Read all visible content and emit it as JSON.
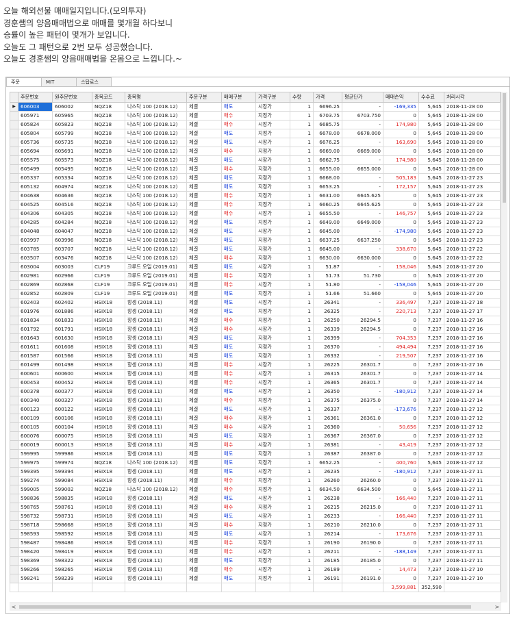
{
  "intro": [
    "오늘 해외선물 매매일지입니다.(모의투자)",
    "경훈쌤의 양음매매법으로 매매를 몇개월 하다보니",
    "승률이 높은 패턴이 몇개가 보입니다.",
    "오늘도 그 패턴으로 2번 모두 성공했습니다.",
    "오늘도 경훈쌤의 양음매매법을 온몸으로 느낍니다.~"
  ],
  "tabs": [
    "주문",
    "MIT",
    "스탑로스"
  ],
  "columns": [
    "주문번호",
    "원주문번호",
    "종목코드",
    "종목명",
    "주문구분",
    "매매구분",
    "가격구분",
    "수량",
    "가격",
    "평균단가",
    "매매손익",
    "수수료",
    "처리시각"
  ],
  "rows": [
    [
      "606003",
      "606002",
      "NQZ18",
      "나스닥 100 (2018.12)",
      "체결",
      "매도",
      "시장가",
      "1",
      "6696.25",
      "-",
      "-169,335",
      "5,645",
      "2018-11-28 00"
    ],
    [
      "605971",
      "605965",
      "NQZ18",
      "나스닥 100 (2018.12)",
      "체결",
      "매수",
      "지정가",
      "1",
      "6703.75",
      "6703.750",
      "0",
      "5,645",
      "2018-11-28 00"
    ],
    [
      "605824",
      "605823",
      "NQZ18",
      "나스닥 100 (2018.12)",
      "체결",
      "매수",
      "시장가",
      "1",
      "6685.75",
      "-",
      "174,980",
      "5,645",
      "2018-11-28 00"
    ],
    [
      "605804",
      "605799",
      "NQZ18",
      "나스닥 100 (2018.12)",
      "체결",
      "매도",
      "지정가",
      "1",
      "6678.00",
      "6678.000",
      "0",
      "5,645",
      "2018-11-28 00"
    ],
    [
      "605736",
      "605735",
      "NQZ18",
      "나스닥 100 (2018.12)",
      "체결",
      "매도",
      "시장가",
      "1",
      "6676.25",
      "-",
      "163,690",
      "5,645",
      "2018-11-28 00"
    ],
    [
      "605694",
      "605691",
      "NQZ18",
      "나스닥 100 (2018.12)",
      "체결",
      "매수",
      "지정가",
      "1",
      "6669.00",
      "6669.000",
      "0",
      "5,645",
      "2018-11-28 00"
    ],
    [
      "605575",
      "605573",
      "NQZ18",
      "나스닥 100 (2018.12)",
      "체결",
      "매도",
      "시장가",
      "1",
      "6662.75",
      "-",
      "174,980",
      "5,645",
      "2018-11-28 00"
    ],
    [
      "605499",
      "605495",
      "NQZ18",
      "나스닥 100 (2018.12)",
      "체결",
      "매수",
      "지정가",
      "1",
      "6655.00",
      "6655.000",
      "0",
      "5,645",
      "2018-11-28 00"
    ],
    [
      "605337",
      "605334",
      "NQZ18",
      "나스닥 100 (2018.12)",
      "체결",
      "매도",
      "지정가",
      "1",
      "6668.00",
      "-",
      "505,183",
      "5,645",
      "2018-11-27 23"
    ],
    [
      "605132",
      "604974",
      "NQZ18",
      "나스닥 100 (2018.12)",
      "체결",
      "매도",
      "지정가",
      "1",
      "6653.25",
      "-",
      "172,157",
      "5,645",
      "2018-11-27 23"
    ],
    [
      "604638",
      "604636",
      "NQZ18",
      "나스닥 100 (2018.12)",
      "체결",
      "매수",
      "지정가",
      "1",
      "6631.00",
      "6645.625",
      "0",
      "5,645",
      "2018-11-27 23"
    ],
    [
      "604525",
      "604516",
      "NQZ18",
      "나스닥 100 (2018.12)",
      "체결",
      "매수",
      "지정가",
      "1",
      "6660.25",
      "6645.625",
      "0",
      "5,645",
      "2018-11-27 23"
    ],
    [
      "604306",
      "604305",
      "NQZ18",
      "나스닥 100 (2018.12)",
      "체결",
      "매수",
      "시장가",
      "1",
      "6655.50",
      "-",
      "146,757",
      "5,645",
      "2018-11-27 23"
    ],
    [
      "604285",
      "604284",
      "NQZ18",
      "나스닥 100 (2018.12)",
      "체결",
      "매도",
      "지정가",
      "1",
      "6649.00",
      "6649.000",
      "0",
      "5,645",
      "2018-11-27 23"
    ],
    [
      "604048",
      "604047",
      "NQZ18",
      "나스닥 100 (2018.12)",
      "체결",
      "매도",
      "시장가",
      "1",
      "6645.00",
      "-",
      "-174,980",
      "5,645",
      "2018-11-27 23"
    ],
    [
      "603997",
      "603996",
      "NQZ18",
      "나스닥 100 (2018.12)",
      "체결",
      "매도",
      "지정가",
      "1",
      "6637.25",
      "6637.250",
      "0",
      "5,645",
      "2018-11-27 23"
    ],
    [
      "603785",
      "603707",
      "NQZ18",
      "나스닥 100 (2018.12)",
      "체결",
      "매도",
      "지정가",
      "1",
      "6645.00",
      "-",
      "338,670",
      "5,645",
      "2018-11-27 22"
    ],
    [
      "603507",
      "603476",
      "NQZ18",
      "나스닥 100 (2018.12)",
      "체결",
      "매수",
      "지정가",
      "1",
      "6630.00",
      "6630.000",
      "0",
      "5,645",
      "2018-11-27 22"
    ],
    [
      "603004",
      "603003",
      "CLF19",
      "크루드 오일 (2019.01)",
      "체결",
      "매도",
      "시장가",
      "1",
      "51.87",
      "-",
      "158,046",
      "5,645",
      "2018-11-27 20"
    ],
    [
      "602981",
      "602966",
      "CLF19",
      "크루드 오일 (2019.01)",
      "체결",
      "매수",
      "지정가",
      "1",
      "51.73",
      "51.730",
      "0",
      "5,645",
      "2018-11-27 20"
    ],
    [
      "602869",
      "602868",
      "CLF19",
      "크루드 오일 (2019.01)",
      "체결",
      "매수",
      "시장가",
      "1",
      "51.80",
      "-",
      "-158,046",
      "5,645",
      "2018-11-27 20"
    ],
    [
      "602852",
      "602809",
      "CLF19",
      "크루드 오일 (2019.01)",
      "체결",
      "매도",
      "지정가",
      "1",
      "51.66",
      "51.660",
      "0",
      "5,645",
      "2018-11-27 20"
    ],
    [
      "602403",
      "602402",
      "HSIX18",
      "항셍 (2018.11)",
      "체결",
      "매도",
      "시장가",
      "1",
      "26341",
      "-",
      "336,497",
      "7,237",
      "2018-11-27 18"
    ],
    [
      "601976",
      "601886",
      "HSIX18",
      "항셍 (2018.11)",
      "체결",
      "매도",
      "지정가",
      "1",
      "26325",
      "-",
      "220,713",
      "7,237",
      "2018-11-27 17"
    ],
    [
      "601834",
      "601833",
      "HSIX18",
      "항셍 (2018.11)",
      "체결",
      "매수",
      "지정가",
      "1",
      "26250",
      "26294.5",
      "0",
      "7,237",
      "2018-11-27 16"
    ],
    [
      "601792",
      "601791",
      "HSIX18",
      "항셍 (2018.11)",
      "체결",
      "매수",
      "시장가",
      "1",
      "26339",
      "26294.5",
      "0",
      "7,237",
      "2018-11-27 16"
    ],
    [
      "601643",
      "601630",
      "HSIX18",
      "항셍 (2018.11)",
      "체결",
      "매도",
      "지정가",
      "1",
      "26399",
      "-",
      "704,353",
      "7,237",
      "2018-11-27 16"
    ],
    [
      "601611",
      "601608",
      "HSIX18",
      "항셍 (2018.11)",
      "체결",
      "매도",
      "지정가",
      "1",
      "26370",
      "-",
      "494,494",
      "7,237",
      "2018-11-27 16"
    ],
    [
      "601587",
      "601566",
      "HSIX18",
      "항셍 (2018.11)",
      "체결",
      "매도",
      "지정가",
      "1",
      "26332",
      "-",
      "219,507",
      "7,237",
      "2018-11-27 16"
    ],
    [
      "601499",
      "601498",
      "HSIX18",
      "항셍 (2018.11)",
      "체결",
      "매수",
      "시장가",
      "1",
      "26225",
      "26301.7",
      "0",
      "7,237",
      "2018-11-27 16"
    ],
    [
      "600601",
      "600600",
      "HSIX18",
      "항셍 (2018.11)",
      "체결",
      "매수",
      "시장가",
      "1",
      "26315",
      "26301.7",
      "0",
      "7,237",
      "2018-11-27 14"
    ],
    [
      "600453",
      "600452",
      "HSIX18",
      "항셍 (2018.11)",
      "체결",
      "매수",
      "시장가",
      "1",
      "26365",
      "26301.7",
      "0",
      "7,237",
      "2018-11-27 14"
    ],
    [
      "600378",
      "600377",
      "HSIX18",
      "항셍 (2018.11)",
      "체결",
      "매도",
      "시장가",
      "1",
      "26350",
      "-",
      "-180,912",
      "7,237",
      "2018-11-27 14"
    ],
    [
      "600340",
      "600327",
      "HSIX18",
      "항셍 (2018.11)",
      "체결",
      "매수",
      "지정가",
      "1",
      "26375",
      "26375.0",
      "0",
      "7,237",
      "2018-11-27 14"
    ],
    [
      "600123",
      "600122",
      "HSIX18",
      "항셍 (2018.11)",
      "체결",
      "매도",
      "시장가",
      "1",
      "26337",
      "-",
      "-173,676",
      "7,237",
      "2018-11-27 12"
    ],
    [
      "600109",
      "600106",
      "HSIX18",
      "항셍 (2018.11)",
      "체결",
      "매수",
      "지정가",
      "1",
      "26361",
      "26361.0",
      "0",
      "7,237",
      "2018-11-27 12"
    ],
    [
      "600105",
      "600104",
      "HSIX18",
      "항셍 (2018.11)",
      "체결",
      "매수",
      "시장가",
      "1",
      "26360",
      "-",
      "50,656",
      "7,237",
      "2018-11-27 12"
    ],
    [
      "600076",
      "600075",
      "HSIX18",
      "항셍 (2018.11)",
      "체결",
      "매도",
      "지정가",
      "1",
      "26367",
      "26367.0",
      "0",
      "7,237",
      "2018-11-27 12"
    ],
    [
      "600019",
      "600013",
      "HSIX18",
      "항셍 (2018.11)",
      "체결",
      "매수",
      "시장가",
      "1",
      "26381",
      "-",
      "43,419",
      "7,237",
      "2018-11-27 12"
    ],
    [
      "599995",
      "599986",
      "HSIX18",
      "항셍 (2018.11)",
      "체결",
      "매도",
      "지정가",
      "1",
      "26387",
      "26387.0",
      "0",
      "7,237",
      "2018-11-27 12"
    ],
    [
      "599975",
      "599974",
      "NQZ18",
      "나스닥 100 (2018.12)",
      "체결",
      "매도",
      "지정가",
      "1",
      "6652.25",
      "-",
      "400,760",
      "5,645",
      "2018-11-27 12"
    ],
    [
      "599395",
      "599394",
      "HSIX18",
      "항셍 (2018.11)",
      "체결",
      "매도",
      "시장가",
      "1",
      "26235",
      "-",
      "-180,912",
      "7,237",
      "2018-11-27 11"
    ],
    [
      "599274",
      "599084",
      "HSIX18",
      "항셍 (2018.11)",
      "체결",
      "매수",
      "지정가",
      "1",
      "26260",
      "26260.0",
      "0",
      "7,237",
      "2018-11-27 11"
    ],
    [
      "599005",
      "599002",
      "NQZ18",
      "나스닥 100 (2018.12)",
      "체결",
      "매수",
      "지정가",
      "1",
      "6634.50",
      "6634.500",
      "0",
      "5,645",
      "2018-11-27 11"
    ],
    [
      "598836",
      "598835",
      "HSIX18",
      "항셍 (2018.11)",
      "체결",
      "매도",
      "시장가",
      "1",
      "26238",
      "-",
      "166,440",
      "7,237",
      "2018-11-27 11"
    ],
    [
      "598765",
      "598761",
      "HSIX18",
      "항셍 (2018.11)",
      "체결",
      "매수",
      "지정가",
      "1",
      "26215",
      "26215.0",
      "0",
      "7,237",
      "2018-11-27 11"
    ],
    [
      "598732",
      "598731",
      "HSIX18",
      "항셍 (2018.11)",
      "체결",
      "매도",
      "시장가",
      "1",
      "26233",
      "-",
      "166,440",
      "7,237",
      "2018-11-27 11"
    ],
    [
      "598718",
      "598668",
      "HSIX18",
      "항셍 (2018.11)",
      "체결",
      "매수",
      "지정가",
      "1",
      "26210",
      "26210.0",
      "0",
      "7,237",
      "2018-11-27 11"
    ],
    [
      "598593",
      "598592",
      "HSIX18",
      "항셍 (2018.11)",
      "체결",
      "매도",
      "시장가",
      "1",
      "26214",
      "-",
      "173,676",
      "7,237",
      "2018-11-27 11"
    ],
    [
      "598487",
      "598486",
      "HSIX18",
      "항셍 (2018.11)",
      "체결",
      "매수",
      "지정가",
      "1",
      "26190",
      "26190.0",
      "0",
      "7,237",
      "2018-11-27 11"
    ],
    [
      "598420",
      "598419",
      "HSIX18",
      "항셍 (2018.11)",
      "체결",
      "매수",
      "시장가",
      "1",
      "26211",
      "-",
      "-188,149",
      "7,237",
      "2018-11-27 11"
    ],
    [
      "598369",
      "598322",
      "HSIX18",
      "항셍 (2018.11)",
      "체결",
      "매도",
      "지정가",
      "1",
      "26185",
      "26185.0",
      "0",
      "7,237",
      "2018-11-27 11"
    ],
    [
      "598266",
      "598265",
      "HSIX18",
      "항셍 (2018.11)",
      "체결",
      "매수",
      "시장가",
      "1",
      "26189",
      "-",
      "14,473",
      "7,237",
      "2018-11-27 10"
    ],
    [
      "598241",
      "598239",
      "HSIX18",
      "항셍 (2018.11)",
      "체결",
      "매도",
      "지정가",
      "1",
      "26191",
      "26191.0",
      "0",
      "7,237",
      "2018-11-27 10"
    ]
  ],
  "totals": {
    "pnl": "3,599,881",
    "fee": "352,590"
  },
  "colors": {
    "buy": "#e02020",
    "sell": "#0a34d8",
    "profit": "#e02020",
    "loss": "#0a34d8",
    "selection": "#1e6fd9"
  },
  "icons": {
    "row_indicator": "row-indicator-icon",
    "scroll_left": "chevron-left-icon",
    "scroll_right": "chevron-right-icon"
  }
}
